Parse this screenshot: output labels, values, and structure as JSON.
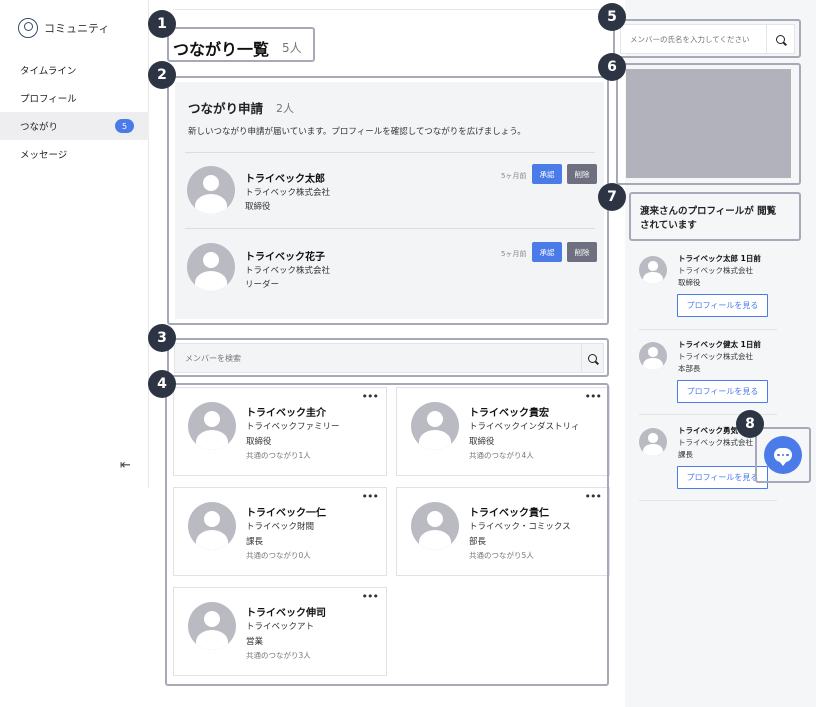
{
  "sidebar": {
    "brand": "コミュニティ",
    "items": [
      {
        "label": "タイムライン"
      },
      {
        "label": "プロフィール"
      },
      {
        "label": "つながり",
        "badge": "5"
      },
      {
        "label": "メッセージ"
      }
    ],
    "collapse_icon": "collapse-left-icon"
  },
  "page": {
    "title": "つながり一覧",
    "count": "5人"
  },
  "requests": {
    "title": "つながり申請",
    "count": "2人",
    "description": "新しいつながり申請が届いています。プロフィールを確認してつながりを広げましょう。",
    "approve_label": "承認",
    "delete_label": "削除",
    "items": [
      {
        "name": "トライベック太郎",
        "company": "トライベック株式会社",
        "role": "取締役",
        "time": "5ヶ月前"
      },
      {
        "name": "トライベック花子",
        "company": "トライベック株式会社",
        "role": "リーダー",
        "time": "5ヶ月前"
      }
    ]
  },
  "member_search": {
    "placeholder": "メンバーを検索"
  },
  "members": [
    {
      "name": "トライベック圭介",
      "company": "トライベックファミリー",
      "role": "取締役",
      "common": "共通のつながり1人"
    },
    {
      "name": "トライベック貴宏",
      "company": "トライベックインダストリィ",
      "role": "取締役",
      "common": "共通のつながり4人"
    },
    {
      "name": "トライベック一仁",
      "company": "トライベック財閥",
      "role": "課長",
      "common": "共通のつながり0人"
    },
    {
      "name": "トライベック貴仁",
      "company": "トライベック・コミックス",
      "role": "部長",
      "common": "共通のつながり5人"
    },
    {
      "name": "トライベック伸司",
      "company": "トライベックアト",
      "role": "営業",
      "common": "共通のつながり3人"
    }
  ],
  "name_search": {
    "placeholder": "メンバーの氏名を入力してください"
  },
  "viewers": {
    "title": "渡来さんのプロフィールが 閲覧されています",
    "button_label": "プロフィールを見る",
    "items": [
      {
        "name": "トライベック太郎 1日前",
        "company": "トライベック株式会社",
        "role": "取締役"
      },
      {
        "name": "トライベック健太 1日前",
        "company": "トライベック株式会社",
        "role": "本部長"
      },
      {
        "name": "トライベック勇気 1日前",
        "company": "トライベック株式会社",
        "role": "課長"
      }
    ]
  },
  "markers": [
    "1",
    "2",
    "3",
    "4",
    "5",
    "6",
    "7",
    "8"
  ],
  "colors": {
    "accent": "#4a7be8",
    "marker": "#2d3545",
    "delete": "#6e6f7f"
  }
}
